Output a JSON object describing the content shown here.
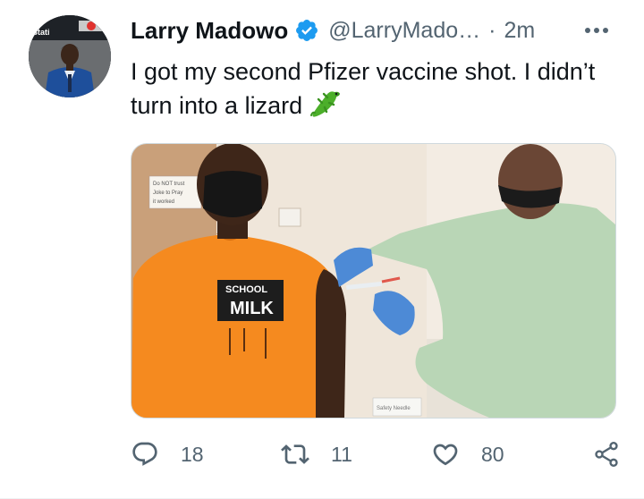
{
  "tweet": {
    "author_name": "Larry Madowo",
    "handle": "@LarryMado…",
    "separator": "·",
    "time": "2m",
    "text": "I got my second Pfizer vaccine shot. I didn’t turn into a lizard",
    "emoji": "lizard-emoji",
    "avatar_sign_text": [
      "ot",
      "Stati"
    ]
  },
  "media": {
    "sign_text": [
      "Do NOT trust",
      "Joke to Pray",
      "it worked"
    ],
    "shirt_text": [
      "SCHOOL",
      "MILK"
    ],
    "box_label": "Safety Needle"
  },
  "actions": {
    "replies": "18",
    "retweets": "11",
    "likes": "80"
  },
  "colors": {
    "text": "#0f1419",
    "secondary": "#536471",
    "verified": "#1d9bf0",
    "shirt": "#f58a1f",
    "lizard": "#4caf2a"
  }
}
